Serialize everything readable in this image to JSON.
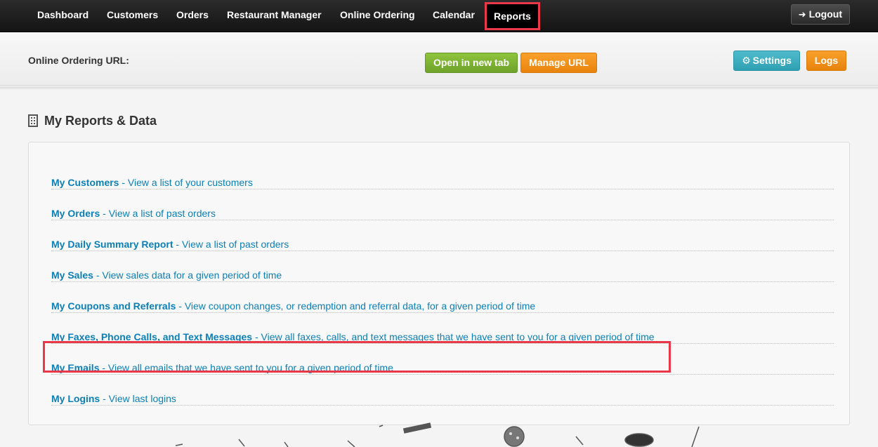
{
  "nav": {
    "items": [
      {
        "label": "Dashboard"
      },
      {
        "label": "Customers"
      },
      {
        "label": "Orders"
      },
      {
        "label": "Restaurant Manager"
      },
      {
        "label": "Online Ordering"
      },
      {
        "label": "Calendar"
      },
      {
        "label": "Reports",
        "active": true
      }
    ],
    "logout_label": "Logout"
  },
  "urlbar": {
    "label": "Online Ordering URL:",
    "open_tab_label": "Open in new tab",
    "manage_url_label": "Manage URL",
    "settings_label": "Settings",
    "logs_label": "Logs"
  },
  "section": {
    "title": "My Reports & Data"
  },
  "reports": [
    {
      "title": "My Customers",
      "desc": " - View a list of your customers"
    },
    {
      "title": "My Orders",
      "desc": " - View a list of past orders"
    },
    {
      "title": "My Daily Summary Report",
      "desc": " - View a list of past orders"
    },
    {
      "title": "My Sales",
      "desc": " - View sales data for a given period of time"
    },
    {
      "title": "My Coupons and Referrals",
      "desc": " - View coupon changes, or redemption and referral data, for a given period of time"
    },
    {
      "title": "My Faxes, Phone Calls, and Text Messages",
      "desc": " - View all faxes, calls, and text messages that we have sent to you for a given period of time"
    },
    {
      "title": "My Emails",
      "desc": " - View all emails that we have sent to you for a given period of time",
      "highlighted": true
    },
    {
      "title": "My Logins",
      "desc": " - View last logins"
    }
  ],
  "colors": {
    "highlight": "#e8384a",
    "link": "#0b7fb8",
    "green_button": "#7ab332",
    "orange_button": "#f0901c",
    "teal_button": "#3aaec0"
  }
}
